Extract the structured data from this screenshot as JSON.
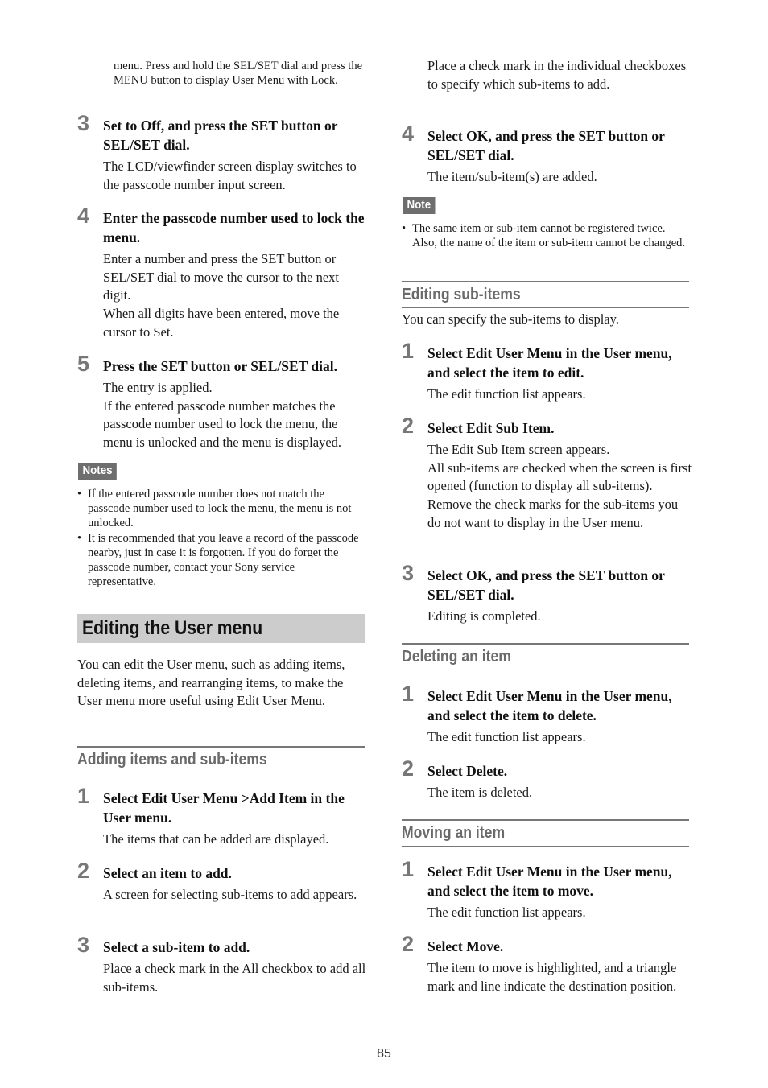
{
  "left_column": {
    "intro_continuation": "menu. Press and hold the SEL/SET dial and press the MENU button to display User Menu with Lock.",
    "unlock_steps": [
      {
        "number": "3",
        "title": "Set to Off, and press the SET button or SEL/SET dial.",
        "description": "The LCD/viewfinder screen display switches to the passcode number input screen."
      },
      {
        "number": "4",
        "title": "Enter the passcode number used to lock the menu.",
        "description": "Enter a number and press the SET button or SEL/SET dial to move the cursor to the next digit.\nWhen all digits have been entered, move the cursor to Set."
      },
      {
        "number": "5",
        "title": "Press the SET button or SEL/SET dial.",
        "description": "The entry is applied.\nIf the entered passcode number matches the passcode number used to lock the menu, the menu is unlocked and the menu is displayed."
      }
    ],
    "notes_label": "Notes",
    "notes": [
      "If the entered passcode number does not match the passcode number used to lock the menu, the menu is not unlocked.",
      "It is recommended that you leave a record of the passcode nearby, just in case it is forgotten. If you do forget the passcode number, contact your Sony service representative."
    ],
    "section_title": "Editing the User menu",
    "section_intro": "You can edit the User menu, such as adding items, deleting items, and rearranging items, to make the User menu more useful using Edit User Menu.",
    "adding_heading": "Adding items and sub-items",
    "adding_steps": [
      {
        "number": "1",
        "title": "Select Edit User Menu >Add Item in the User menu.",
        "description": "The items that can be added are displayed."
      },
      {
        "number": "2",
        "title": "Select an item to add.",
        "description": "A screen for selecting sub-items to add appears."
      },
      {
        "number": "3",
        "title": "Select a sub-item to add.",
        "description": "Place a check mark in the All checkbox to add all sub-items."
      }
    ]
  },
  "right_column": {
    "adding_continuation": "Place a check mark in the individual checkboxes to specify which sub-items to add.",
    "adding_step4": {
      "number": "4",
      "title": "Select OK, and press the SET button or SEL/SET dial.",
      "description": "The item/sub-item(s) are added."
    },
    "note_label": "Note",
    "note": "The same item or sub-item cannot be registered twice. Also, the name of the item or sub-item cannot be changed.",
    "editing_sub_heading": "Editing sub-items",
    "editing_sub_intro": "You can specify the sub-items to display.",
    "editing_sub_steps": [
      {
        "number": "1",
        "title": "Select Edit User Menu in the User menu, and select the item to edit.",
        "description": "The edit function list appears."
      },
      {
        "number": "2",
        "title": "Select Edit Sub Item.",
        "description": "The Edit Sub Item screen appears.\nAll sub-items are checked when the screen is first opened (function to display all sub-items).\nRemove the check marks for the sub-items you do not want to display in the User menu."
      },
      {
        "number": "3",
        "title": "Select OK, and press the SET button or SEL/SET dial.",
        "description": "Editing is completed."
      }
    ],
    "deleting_heading": "Deleting an item",
    "deleting_steps": [
      {
        "number": "1",
        "title": "Select Edit User Menu in the User menu, and select the item to delete.",
        "description": "The edit function list appears."
      },
      {
        "number": "2",
        "title": "Select Delete.",
        "description": "The item is deleted."
      }
    ],
    "moving_heading": "Moving an item",
    "moving_steps": [
      {
        "number": "1",
        "title": "Select Edit User Menu in the User menu, and select the item to move.",
        "description": "The edit function list appears."
      },
      {
        "number": "2",
        "title": "Select Move.",
        "description": "The item to move is highlighted, and a triangle mark and line indicate the destination position."
      }
    ]
  },
  "page_number": "85"
}
